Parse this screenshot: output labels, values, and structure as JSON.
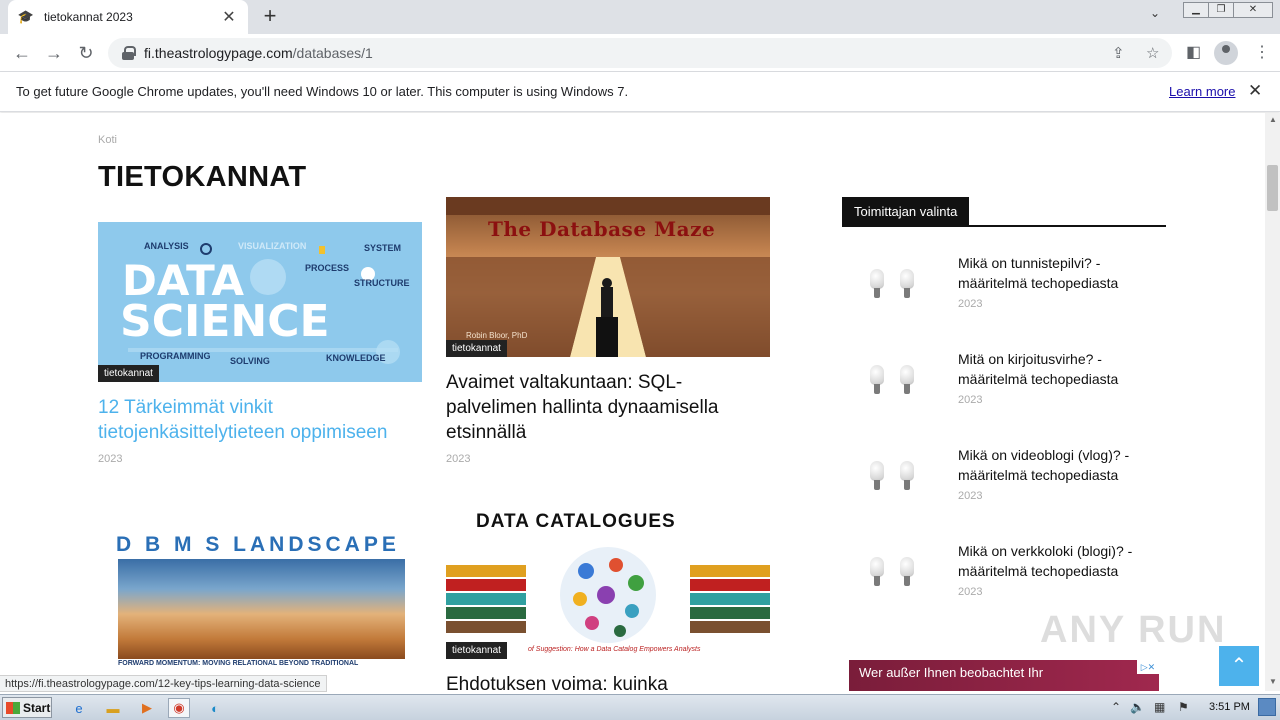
{
  "browser": {
    "tab_title": "tietokannat 2023",
    "url_host": "fi.theastrologypage.com",
    "url_path": "/databases/1",
    "infobar_text": "To get future Google Chrome updates, you'll need Windows 10 or later. This computer is using Windows 7.",
    "infobar_link": "Learn more",
    "status_url": "https://fi.theastrologypage.com/12-key-tips-learning-data-science"
  },
  "page": {
    "breadcrumb": "Koti",
    "title": "TIETOKANNAT",
    "articles": [
      {
        "category": "tietokannat",
        "title": "12 Tärkeimmät vinkit tietojenkäsittelytieteen oppimiseen",
        "year": "2023",
        "image_words": {
          "big1": "DATA",
          "big2": "SCIENCE",
          "analysis": "ANALYSIS",
          "visualization": "VISUALIZATION",
          "system": "SYSTEM",
          "process": "PROCESS",
          "structure": "STRUCTURE",
          "programming": "PROGRAMMING",
          "solving": "SOLVING",
          "knowledge": "KNOWLEDGE"
        }
      },
      {
        "category": "tietokannat",
        "title": "Avaimet valtakuntaan: SQL-palvelimen hallinta dynaamisella etsinnällä",
        "year": "2023",
        "image_title": "The Database Maze",
        "image_credit": "Robin Bloor, PhD"
      },
      {
        "category": "",
        "title": "",
        "year": "",
        "image_title": "D B M S  LANDSCAPE",
        "image_caption": "FORWARD MOMENTUM: MOVING RELATIONAL BEYOND TRADITIONAL"
      },
      {
        "category": "tietokannat",
        "title": "Ehdotuksen voima: kuinka",
        "year": "",
        "image_title": "DATA  CATALOGUES",
        "image_caption": "of Suggestion: How a Data Catalog Empowers Analysts"
      }
    ]
  },
  "sidebar": {
    "heading": "Toimittajan valinta",
    "items": [
      {
        "title": "Mikä on tunnistepilvi? - määritelmä techopediasta",
        "year": "2023"
      },
      {
        "title": "Mitä on kirjoitusvirhe? - määritelmä techopediasta",
        "year": "2023"
      },
      {
        "title": "Mikä on videoblogi (vlog)? - määritelmä techopediasta",
        "year": "2023"
      },
      {
        "title": "Mikä on verkkoloki (blogi)? - määritelmä techopediasta",
        "year": "2023"
      }
    ],
    "ad_text": "Wer außer Ihnen beobachtet Ihr"
  },
  "watermark": "ANY RUN",
  "taskbar": {
    "start_label": "Start",
    "clock": "3:51 PM"
  },
  "colors": {
    "link_blue": "#4db2ec",
    "badge_black": "#222222"
  }
}
